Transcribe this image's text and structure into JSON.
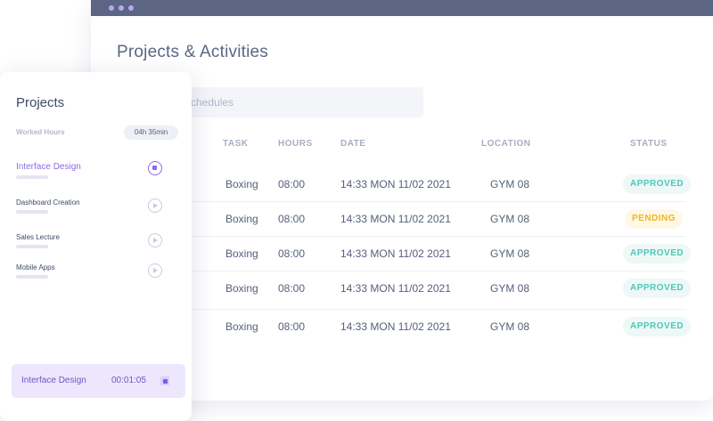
{
  "window": {
    "title": "Projects & Activities",
    "search_placeholder": "chedules"
  },
  "table": {
    "headers": {
      "task": "TASK",
      "hours": "HOURS",
      "date": "DATE",
      "location": "LOCATION",
      "status": "STATUS"
    },
    "rows": [
      {
        "task": "Boxing",
        "hours": "08:00",
        "date": "14:33 MON 11/02 2021",
        "location": "GYM 08",
        "status": "APPROVED",
        "status_type": "approved"
      },
      {
        "task": "Boxing",
        "hours": "08:00",
        "date": "14:33 MON 11/02 2021",
        "location": "GYM 08",
        "status": "PENDING",
        "status_type": "pending"
      },
      {
        "task": "Boxing",
        "hours": "08:00",
        "date": "14:33 MON 11/02 2021",
        "location": "GYM 08",
        "status": "APPROVED",
        "status_type": "approved"
      },
      {
        "task": "Boxing",
        "hours": "08:00",
        "date": "14:33 MON 11/02 2021",
        "location": "GYM 08",
        "status": "APPROVED",
        "status_type": "approved"
      },
      {
        "task": "Boxing",
        "hours": "08:00",
        "date": "14:33 MON 11/02 2021",
        "location": "GYM 08",
        "status": "APPROVED",
        "status_type": "approved"
      }
    ]
  },
  "panel": {
    "title": "Projects",
    "worked_hours_label": "Worked Hours",
    "worked_hours_value": "04h 35min",
    "projects": [
      {
        "name": "Interface Design",
        "active": true,
        "icon": "stop-icon"
      },
      {
        "name": "Dashboard Creation",
        "active": false,
        "icon": "play-icon"
      },
      {
        "name": "Sales Lecture",
        "active": false,
        "icon": "play-icon"
      },
      {
        "name": "Mobile Apps",
        "active": false,
        "icon": "play-icon"
      }
    ],
    "timer": {
      "name": "Interface Design",
      "time": "00:01:05",
      "icon": "stop-icon"
    }
  },
  "colors": {
    "titlebar": "#5c6584",
    "accent": "#8b6ae6",
    "approved": "#52c6b7",
    "pending": "#f0b52a"
  }
}
